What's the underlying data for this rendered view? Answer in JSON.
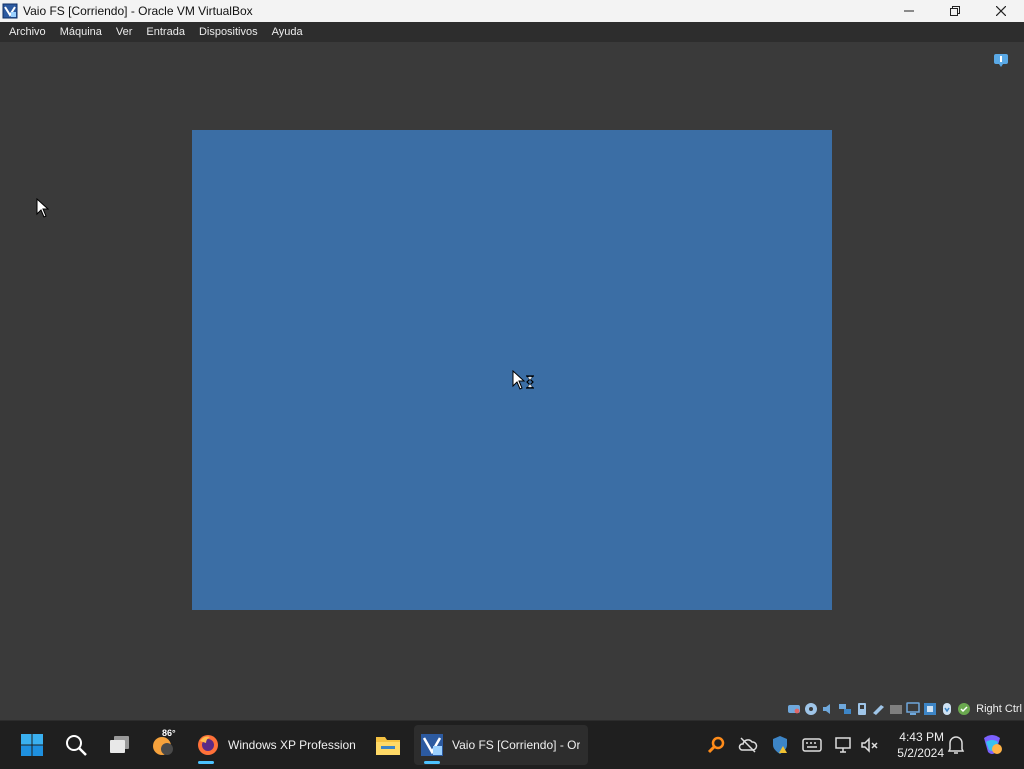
{
  "window": {
    "title": "Vaio FS [Corriendo] - Oracle VM VirtualBox"
  },
  "menu": [
    "Archivo",
    "Máquina",
    "Ver",
    "Entrada",
    "Dispositivos",
    "Ayuda"
  ],
  "statusbar": {
    "host_key": "Right Ctrl",
    "icons": [
      "hard-disk-icon",
      "optical-disk-icon",
      "audio-icon",
      "network-icon",
      "usb-icon",
      "shared-folders-icon",
      "display-icon",
      "recording-icon",
      "cpu-icon",
      "mouse-integration-icon",
      "keyboard-icon"
    ]
  },
  "taskbar": {
    "weather_temp": "86°",
    "apps": [
      {
        "label": "Windows XP Professional"
      },
      {
        "label": "Vaio FS [Corriendo] - Oracle VM VirtualBox"
      }
    ]
  },
  "clock": {
    "time": "4:43 PM",
    "date": "5/2/2024"
  },
  "colors": {
    "guest_screen": "#3b6ea5",
    "vm_background": "#3a3a3a",
    "taskbar": "#1f1f1f",
    "accent": "#4cc2ff"
  }
}
